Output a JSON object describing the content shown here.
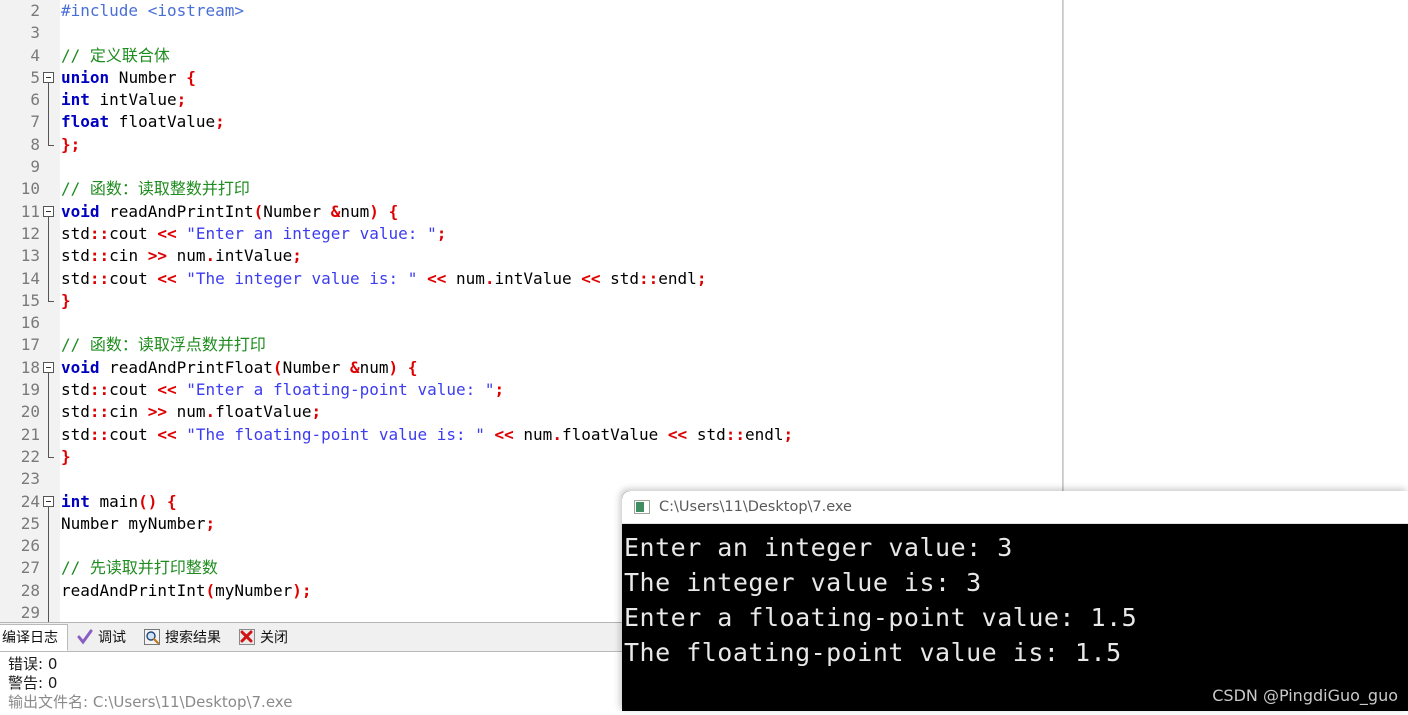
{
  "editor": {
    "gutter_start_line": 2,
    "lines": [
      {
        "num": "2",
        "fold": "none",
        "bar": false,
        "segments": [
          {
            "t": "#include <iostream>",
            "c": "pre"
          }
        ]
      },
      {
        "num": "3",
        "fold": "none",
        "bar": false,
        "segments": []
      },
      {
        "num": "4",
        "fold": "none",
        "bar": false,
        "segments": [
          {
            "t": "// 定义联合体",
            "c": "cmt"
          }
        ]
      },
      {
        "num": "5",
        "fold": "start",
        "bar": false,
        "segments": [
          {
            "t": "union",
            "c": "kw"
          },
          {
            "t": " Number ",
            "c": "plain"
          },
          {
            "t": "{",
            "c": "punct"
          }
        ]
      },
      {
        "num": "6",
        "fold": "mid",
        "bar": true,
        "segments": [
          {
            "t": "int",
            "c": "kw"
          },
          {
            "t": " intValue",
            "c": "plain"
          },
          {
            "t": ";",
            "c": "punct"
          }
        ]
      },
      {
        "num": "7",
        "fold": "mid",
        "bar": true,
        "segments": [
          {
            "t": "float",
            "c": "kw"
          },
          {
            "t": " floatValue",
            "c": "plain"
          },
          {
            "t": ";",
            "c": "punct"
          }
        ]
      },
      {
        "num": "8",
        "fold": "end",
        "bar": false,
        "segments": [
          {
            "t": "}",
            "c": "punct"
          },
          {
            "t": ";",
            "c": "punct"
          }
        ]
      },
      {
        "num": "9",
        "fold": "none",
        "bar": false,
        "segments": []
      },
      {
        "num": "10",
        "fold": "none",
        "bar": false,
        "segments": [
          {
            "t": "// 函数：读取整数并打印",
            "c": "cmt"
          }
        ]
      },
      {
        "num": "11",
        "fold": "start",
        "bar": false,
        "segments": [
          {
            "t": "void",
            "c": "kw"
          },
          {
            "t": " readAndPrintInt",
            "c": "plain"
          },
          {
            "t": "(",
            "c": "punct"
          },
          {
            "t": "Number ",
            "c": "plain"
          },
          {
            "t": "&",
            "c": "punct"
          },
          {
            "t": "num",
            "c": "plain"
          },
          {
            "t": ")",
            "c": "punct"
          },
          {
            "t": " ",
            "c": "plain"
          },
          {
            "t": "{",
            "c": "punct"
          }
        ]
      },
      {
        "num": "12",
        "fold": "mid",
        "bar": true,
        "segments": [
          {
            "t": "std",
            "c": "plain"
          },
          {
            "t": "::",
            "c": "punct"
          },
          {
            "t": "cout ",
            "c": "plain"
          },
          {
            "t": "<<",
            "c": "punct"
          },
          {
            "t": " ",
            "c": "plain"
          },
          {
            "t": "\"Enter an integer value: \"",
            "c": "str"
          },
          {
            "t": ";",
            "c": "punct"
          }
        ]
      },
      {
        "num": "13",
        "fold": "mid",
        "bar": true,
        "segments": [
          {
            "t": "std",
            "c": "plain"
          },
          {
            "t": "::",
            "c": "punct"
          },
          {
            "t": "cin ",
            "c": "plain"
          },
          {
            "t": ">>",
            "c": "punct"
          },
          {
            "t": " num",
            "c": "plain"
          },
          {
            "t": ".",
            "c": "punct"
          },
          {
            "t": "intValue",
            "c": "plain"
          },
          {
            "t": ";",
            "c": "punct"
          }
        ]
      },
      {
        "num": "14",
        "fold": "mid",
        "bar": true,
        "segments": [
          {
            "t": "std",
            "c": "plain"
          },
          {
            "t": "::",
            "c": "punct"
          },
          {
            "t": "cout ",
            "c": "plain"
          },
          {
            "t": "<<",
            "c": "punct"
          },
          {
            "t": " ",
            "c": "plain"
          },
          {
            "t": "\"The integer value is: \"",
            "c": "str"
          },
          {
            "t": " ",
            "c": "plain"
          },
          {
            "t": "<<",
            "c": "punct"
          },
          {
            "t": " num",
            "c": "plain"
          },
          {
            "t": ".",
            "c": "punct"
          },
          {
            "t": "intValue ",
            "c": "plain"
          },
          {
            "t": "<<",
            "c": "punct"
          },
          {
            "t": " std",
            "c": "plain"
          },
          {
            "t": "::",
            "c": "punct"
          },
          {
            "t": "endl",
            "c": "plain"
          },
          {
            "t": ";",
            "c": "punct"
          }
        ]
      },
      {
        "num": "15",
        "fold": "end",
        "bar": false,
        "segments": [
          {
            "t": "}",
            "c": "punct"
          }
        ]
      },
      {
        "num": "16",
        "fold": "none",
        "bar": false,
        "segments": []
      },
      {
        "num": "17",
        "fold": "none",
        "bar": false,
        "segments": [
          {
            "t": "// 函数：读取浮点数并打印",
            "c": "cmt"
          }
        ]
      },
      {
        "num": "18",
        "fold": "start",
        "bar": false,
        "segments": [
          {
            "t": "void",
            "c": "kw"
          },
          {
            "t": " readAndPrintFloat",
            "c": "plain"
          },
          {
            "t": "(",
            "c": "punct"
          },
          {
            "t": "Number ",
            "c": "plain"
          },
          {
            "t": "&",
            "c": "punct"
          },
          {
            "t": "num",
            "c": "plain"
          },
          {
            "t": ")",
            "c": "punct"
          },
          {
            "t": " ",
            "c": "plain"
          },
          {
            "t": "{",
            "c": "punct"
          }
        ]
      },
      {
        "num": "19",
        "fold": "mid",
        "bar": true,
        "segments": [
          {
            "t": "std",
            "c": "plain"
          },
          {
            "t": "::",
            "c": "punct"
          },
          {
            "t": "cout ",
            "c": "plain"
          },
          {
            "t": "<<",
            "c": "punct"
          },
          {
            "t": " ",
            "c": "plain"
          },
          {
            "t": "\"Enter a floating-point value: \"",
            "c": "str"
          },
          {
            "t": ";",
            "c": "punct"
          }
        ]
      },
      {
        "num": "20",
        "fold": "mid",
        "bar": true,
        "segments": [
          {
            "t": "std",
            "c": "plain"
          },
          {
            "t": "::",
            "c": "punct"
          },
          {
            "t": "cin ",
            "c": "plain"
          },
          {
            "t": ">>",
            "c": "punct"
          },
          {
            "t": " num",
            "c": "plain"
          },
          {
            "t": ".",
            "c": "punct"
          },
          {
            "t": "floatValue",
            "c": "plain"
          },
          {
            "t": ";",
            "c": "punct"
          }
        ]
      },
      {
        "num": "21",
        "fold": "mid",
        "bar": true,
        "segments": [
          {
            "t": "std",
            "c": "plain"
          },
          {
            "t": "::",
            "c": "punct"
          },
          {
            "t": "cout ",
            "c": "plain"
          },
          {
            "t": "<<",
            "c": "punct"
          },
          {
            "t": " ",
            "c": "plain"
          },
          {
            "t": "\"The floating-point value is: \"",
            "c": "str"
          },
          {
            "t": " ",
            "c": "plain"
          },
          {
            "t": "<<",
            "c": "punct"
          },
          {
            "t": " num",
            "c": "plain"
          },
          {
            "t": ".",
            "c": "punct"
          },
          {
            "t": "floatValue ",
            "c": "plain"
          },
          {
            "t": "<<",
            "c": "punct"
          },
          {
            "t": " std",
            "c": "plain"
          },
          {
            "t": "::",
            "c": "punct"
          },
          {
            "t": "endl",
            "c": "plain"
          },
          {
            "t": ";",
            "c": "punct"
          }
        ]
      },
      {
        "num": "22",
        "fold": "end",
        "bar": false,
        "segments": [
          {
            "t": "}",
            "c": "punct"
          }
        ]
      },
      {
        "num": "23",
        "fold": "none",
        "bar": false,
        "segments": []
      },
      {
        "num": "24",
        "fold": "start",
        "bar": false,
        "segments": [
          {
            "t": "int",
            "c": "kw"
          },
          {
            "t": " main",
            "c": "plain"
          },
          {
            "t": "()",
            "c": "punct"
          },
          {
            "t": " ",
            "c": "plain"
          },
          {
            "t": "{",
            "c": "punct"
          }
        ]
      },
      {
        "num": "25",
        "fold": "mid",
        "bar": true,
        "segments": [
          {
            "t": "Number myNumber",
            "c": "plain"
          },
          {
            "t": ";",
            "c": "punct"
          }
        ]
      },
      {
        "num": "26",
        "fold": "mid",
        "bar": true,
        "segments": []
      },
      {
        "num": "27",
        "fold": "mid",
        "bar": true,
        "segments": [
          {
            "t": "// 先读取并打印整数",
            "c": "cmt"
          }
        ]
      },
      {
        "num": "28",
        "fold": "mid",
        "bar": true,
        "segments": [
          {
            "t": "readAndPrintInt",
            "c": "plain"
          },
          {
            "t": "(",
            "c": "punct"
          },
          {
            "t": "myNumber",
            "c": "plain"
          },
          {
            "t": ")",
            "c": "punct"
          },
          {
            "t": ";",
            "c": "punct"
          }
        ]
      },
      {
        "num": "29",
        "fold": "mid",
        "bar": true,
        "segments": []
      }
    ]
  },
  "log_panel": {
    "tabs": [
      {
        "label": "编译日志",
        "icon": "compile-log-icon",
        "active": true,
        "has_icon": false
      },
      {
        "label": "调试",
        "icon": "check-icon",
        "active": false,
        "has_icon": true
      },
      {
        "label": "搜索结果",
        "icon": "magnifier-icon",
        "active": false,
        "has_icon": true
      },
      {
        "label": "关闭",
        "icon": "close-x-icon",
        "active": false,
        "has_icon": true
      }
    ],
    "lines": [
      "错误: 0",
      "警告: 0",
      "输出文件名: C:\\Users\\11\\Desktop\\7.exe"
    ]
  },
  "console": {
    "title": "C:\\Users\\11\\Desktop\\7.exe",
    "icon": "console-app-icon",
    "output": [
      "Enter an integer value: 3",
      "The integer value is: 3",
      "Enter a floating-point value: 1.5",
      "The floating-point value is: 1.5"
    ]
  },
  "watermark": "CSDN @PingdiGuo_guo",
  "colors": {
    "keyword": "#0000c0",
    "string": "#3c3cf0",
    "comment": "#1f8c1f",
    "punct": "#dd0000",
    "preproc": "#4a6fd4",
    "gutter_bg": "#f2f2f2",
    "console_bg": "#000000"
  }
}
